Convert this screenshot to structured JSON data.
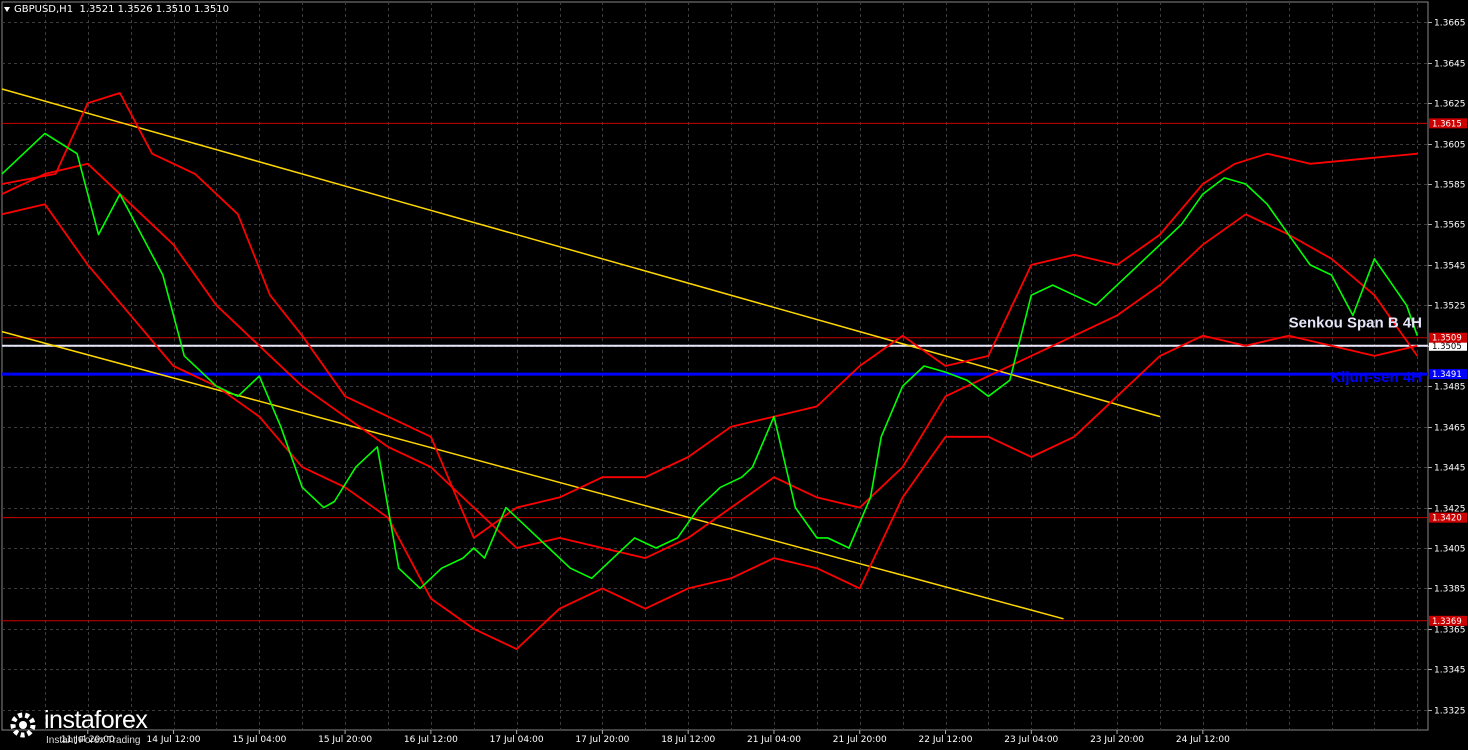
{
  "header": {
    "symbol": "GBPUSD,H1",
    "ohlc": "1.3521 1.3526 1.3510 1.3510"
  },
  "watermark": {
    "brand": "instaforex",
    "tagline": "Instant Forex Trading"
  },
  "colors": {
    "background": "#000000",
    "grid": "#3c3c3c",
    "price": "#00ff00",
    "bollinger": "#ff0000",
    "channel": "#ffd700",
    "level": "#cc0000",
    "kijun": "#0000ff",
    "senkou": "#e6e6fa"
  },
  "chart_data": {
    "type": "line",
    "title": "GBPUSD,H1",
    "ylim": [
      1.3315,
      1.3675
    ],
    "grid": true,
    "y_ticks": [
      "1.3665",
      "1.3645",
      "1.3625",
      "1.3605",
      "1.3585",
      "1.3565",
      "1.3545",
      "1.3525",
      "1.3505",
      "1.3485",
      "1.3465",
      "1.3445",
      "1.3425",
      "1.3405",
      "1.3385",
      "1.3365",
      "1.3345",
      "1.3325"
    ],
    "x_ticks": [
      "11 Jul 20:00",
      "14 Jul 12:00",
      "15 Jul 04:00",
      "15 Jul 20:00",
      "16 Jul 12:00",
      "17 Jul 04:00",
      "17 Jul 20:00",
      "18 Jul 12:00",
      "21 Jul 04:00",
      "21 Jul 20:00",
      "22 Jul 12:00",
      "23 Jul 04:00",
      "23 Jul 20:00",
      "24 Jul 12:00"
    ],
    "x_tick_index": [
      16,
      32,
      48,
      64,
      80,
      96,
      112,
      128,
      144,
      160,
      176,
      192,
      208,
      224
    ],
    "bars_total": 266,
    "price_line": {
      "name": "GBPUSD,H1",
      "x": [
        0,
        8,
        14,
        18,
        22,
        26,
        30,
        34,
        38,
        40,
        44,
        48,
        52,
        56,
        60,
        62,
        66,
        70,
        74,
        78,
        82,
        86,
        88,
        90,
        94,
        98,
        102,
        106,
        110,
        114,
        118,
        122,
        126,
        130,
        134,
        138,
        140,
        144,
        148,
        152,
        154,
        158,
        162,
        164,
        168,
        172,
        176,
        180,
        184,
        188,
        192,
        196,
        200,
        204,
        208,
        212,
        216,
        220,
        224,
        228,
        232,
        236,
        240,
        244,
        248,
        252,
        256,
        262,
        264
      ],
      "y": [
        1.359,
        1.361,
        1.36,
        1.356,
        1.358,
        1.356,
        1.354,
        1.35,
        1.349,
        1.3485,
        1.348,
        1.349,
        1.3465,
        1.3435,
        1.3425,
        1.3428,
        1.3445,
        1.3455,
        1.3395,
        1.3385,
        1.3395,
        1.34,
        1.3405,
        1.34,
        1.3425,
        1.3415,
        1.3405,
        1.3395,
        1.339,
        1.34,
        1.341,
        1.3405,
        1.341,
        1.3425,
        1.3435,
        1.344,
        1.3445,
        1.347,
        1.3425,
        1.341,
        1.341,
        1.3405,
        1.343,
        1.346,
        1.3485,
        1.3495,
        1.3492,
        1.3488,
        1.348,
        1.3488,
        1.353,
        1.3535,
        1.353,
        1.3525,
        1.3535,
        1.3545,
        1.3555,
        1.3565,
        1.358,
        1.3588,
        1.3585,
        1.3575,
        1.356,
        1.3545,
        1.354,
        1.352,
        1.3548,
        1.3525,
        1.351
      ]
    },
    "bollinger_upper": {
      "x": [
        0,
        10,
        16,
        22,
        28,
        36,
        44,
        50,
        56,
        64,
        72,
        80,
        88,
        96,
        104,
        112,
        120,
        128,
        136,
        144,
        152,
        160,
        168,
        176,
        184,
        192,
        200,
        208,
        216,
        224,
        230,
        236,
        244,
        256,
        264
      ],
      "y": [
        1.3585,
        1.359,
        1.3625,
        1.363,
        1.36,
        1.359,
        1.357,
        1.353,
        1.351,
        1.348,
        1.347,
        1.346,
        1.341,
        1.3425,
        1.343,
        1.344,
        1.344,
        1.345,
        1.3465,
        1.347,
        1.3475,
        1.3495,
        1.351,
        1.3495,
        1.35,
        1.3545,
        1.355,
        1.3545,
        1.356,
        1.3585,
        1.3595,
        1.36,
        1.3595,
        1.3598,
        1.36
      ]
    },
    "bollinger_middle": {
      "x": [
        0,
        8,
        16,
        24,
        32,
        40,
        48,
        56,
        64,
        72,
        80,
        88,
        96,
        104,
        112,
        120,
        128,
        136,
        144,
        152,
        160,
        168,
        176,
        184,
        192,
        200,
        208,
        216,
        224,
        232,
        240,
        248,
        256,
        264
      ],
      "y": [
        1.358,
        1.359,
        1.3595,
        1.3575,
        1.3555,
        1.3525,
        1.3505,
        1.3485,
        1.347,
        1.3455,
        1.3445,
        1.3425,
        1.3405,
        1.341,
        1.3405,
        1.34,
        1.341,
        1.3425,
        1.344,
        1.343,
        1.3425,
        1.3445,
        1.348,
        1.349,
        1.35,
        1.351,
        1.352,
        1.3535,
        1.3555,
        1.357,
        1.356,
        1.3548,
        1.353,
        1.35
      ]
    },
    "bollinger_lower": {
      "x": [
        0,
        8,
        16,
        24,
        32,
        40,
        48,
        56,
        64,
        72,
        80,
        88,
        96,
        104,
        112,
        120,
        128,
        136,
        144,
        152,
        160,
        168,
        176,
        184,
        192,
        200,
        208,
        216,
        224,
        232,
        240,
        248,
        256,
        264
      ],
      "y": [
        1.357,
        1.3575,
        1.3545,
        1.352,
        1.3495,
        1.3485,
        1.347,
        1.3445,
        1.3435,
        1.342,
        1.338,
        1.3365,
        1.3355,
        1.3375,
        1.3385,
        1.3375,
        1.3385,
        1.339,
        1.34,
        1.3395,
        1.3385,
        1.343,
        1.346,
        1.346,
        1.345,
        1.346,
        1.348,
        1.35,
        1.351,
        1.3505,
        1.351,
        1.3505,
        1.35,
        1.3505
      ]
    },
    "channel_upper": {
      "x": [
        0,
        216
      ],
      "y": [
        1.3632,
        1.347
      ]
    },
    "channel_lower": {
      "x": [
        0,
        198
      ],
      "y": [
        1.3512,
        1.337
      ]
    },
    "levels": [
      {
        "label": "1.3615",
        "value": 1.3615,
        "color": "#cc0000",
        "width": 1
      },
      {
        "label": "1.3505",
        "value": 1.3505,
        "color": "#e6e6fa",
        "width": 2
      },
      {
        "label": "1.3509",
        "value": 1.3509,
        "color": "#cc0000",
        "width": 1
      },
      {
        "label": "1.3491",
        "value": 1.3491,
        "color": "#0000ff",
        "width": 3
      },
      {
        "label": "1.3420",
        "value": 1.342,
        "color": "#cc0000",
        "width": 1
      },
      {
        "label": "1.3369",
        "value": 1.3369,
        "color": "#cc0000",
        "width": 1
      }
    ],
    "annotations": [
      {
        "text": "Senkou Span B 4H",
        "value": 1.3512,
        "color": "#e6e6fa"
      },
      {
        "text": "Kijun-sen 4H",
        "value": 1.3485,
        "color": "#0000ff"
      }
    ]
  }
}
